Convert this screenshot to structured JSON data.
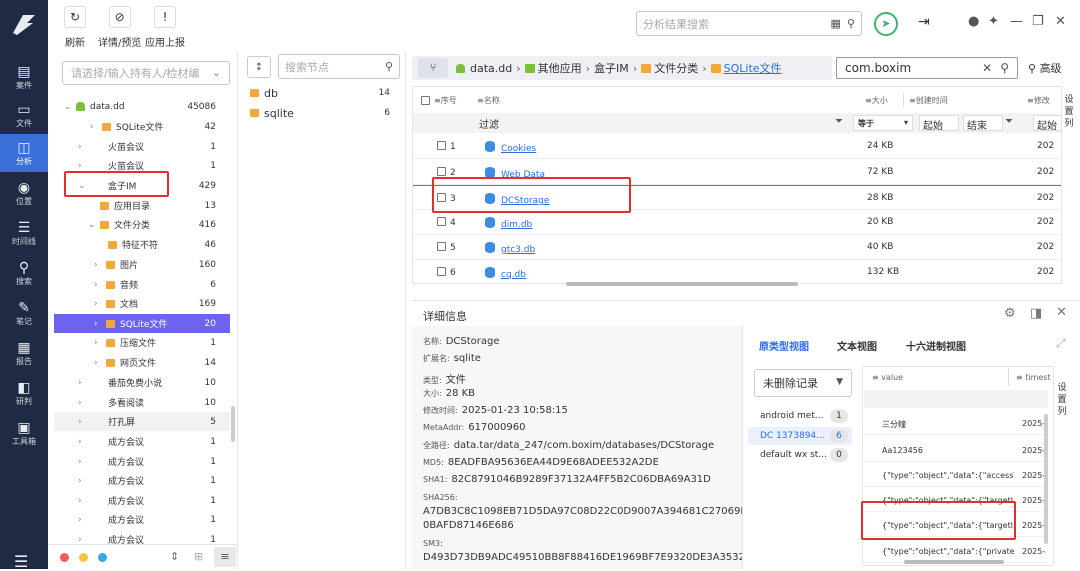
{
  "toolbar": {
    "refresh": "刷新",
    "details": "详情/预览",
    "report": "应用上报",
    "result_search_placeholder": "分析结果搜索"
  },
  "nav": [
    {
      "label": "案件",
      "icon": "case-icon"
    },
    {
      "label": "文件",
      "icon": "file-icon"
    },
    {
      "label": "分析",
      "icon": "analysis-icon"
    },
    {
      "label": "位置",
      "icon": "location-icon"
    },
    {
      "label": "时间线",
      "icon": "timeline-icon"
    },
    {
      "label": "搜索",
      "icon": "search-icon"
    },
    {
      "label": "笔记",
      "icon": "notes-icon"
    },
    {
      "label": "报告",
      "icon": "report-icon"
    },
    {
      "label": "研判",
      "icon": "judge-icon"
    },
    {
      "label": "工具箱",
      "icon": "toolbox-icon"
    }
  ],
  "tree": {
    "evidence_placeholder": "请选择/输入持有人/检材编",
    "rows": [
      {
        "label": "data.dd",
        "count": "45086"
      },
      {
        "label": "SQLite文件",
        "count": "42"
      },
      {
        "label": "火苗会议",
        "count": "1"
      },
      {
        "label": "火苗会议",
        "count": "1"
      },
      {
        "label": "盒子IM",
        "count": "429"
      },
      {
        "label": "应用目录",
        "count": "13"
      },
      {
        "label": "文件分类",
        "count": "416"
      },
      {
        "label": "特征不符",
        "count": "46"
      },
      {
        "label": "图片",
        "count": "160"
      },
      {
        "label": "音频",
        "count": "6"
      },
      {
        "label": "文档",
        "count": "169"
      },
      {
        "label": "SQLite文件",
        "count": "20"
      },
      {
        "label": "压缩文件",
        "count": "1"
      },
      {
        "label": "网页文件",
        "count": "14"
      },
      {
        "label": "番茄免费小说",
        "count": "10"
      },
      {
        "label": "多看阅读",
        "count": "10"
      },
      {
        "label": "打孔屏",
        "count": "5"
      },
      {
        "label": "成方会议",
        "count": "1"
      },
      {
        "label": "成方会议",
        "count": "1"
      },
      {
        "label": "成方会议",
        "count": "1"
      },
      {
        "label": "成方会议",
        "count": "1"
      },
      {
        "label": "成方会议",
        "count": "1"
      },
      {
        "label": "成方会议",
        "count": "1"
      }
    ]
  },
  "nodes": {
    "search_placeholder": "搜索节点",
    "items": [
      {
        "label": "db",
        "count": "14"
      },
      {
        "label": "sqlite",
        "count": "6"
      }
    ]
  },
  "breadcrumb": [
    "data.dd",
    "其他应用",
    "盒子IM",
    "文件分类",
    "SQLite文件"
  ],
  "filter": {
    "value": "com.boxim",
    "advanced": "高级"
  },
  "grid": {
    "headers": [
      "序号",
      "名称",
      "大小",
      "创建时间",
      "修改"
    ],
    "filter_label": "过滤",
    "size_op": "等于",
    "start": "起始",
    "end": "结束",
    "start2": "起始",
    "set_columns": "设置列",
    "rows": [
      {
        "num": "1",
        "name": "Cookies",
        "size": "24 KB",
        "date": "202"
      },
      {
        "num": "2",
        "name": "Web Data",
        "size": "72 KB",
        "date": "202"
      },
      {
        "num": "3",
        "name": "DCStorage",
        "size": "28 KB",
        "date": "202"
      },
      {
        "num": "4",
        "name": "dim.db",
        "size": "20 KB",
        "date": "202"
      },
      {
        "num": "5",
        "name": "gtc3.db",
        "size": "40 KB",
        "date": "202"
      },
      {
        "num": "6",
        "name": "cq.db",
        "size": "132 KB",
        "date": "202"
      }
    ]
  },
  "detail": {
    "title": "详细信息",
    "fields": [
      {
        "k": "名称:",
        "v": "DCStorage"
      },
      {
        "k": "扩展名:",
        "v": "sqlite"
      },
      {
        "k": "类型:",
        "v": "文件"
      },
      {
        "k": "大小:",
        "v": "28 KB"
      },
      {
        "k": "修改时间:",
        "v": "2025-01-23 10:58:15"
      },
      {
        "k": "MetaAddr:",
        "v": "617000960"
      },
      {
        "k": "全路径:",
        "v": "data.tar/data_247/com.boxim/databases/DCStorage"
      },
      {
        "k": "MD5:",
        "v": "8EADFBA95636EA44D9E68ADEE532A2DE"
      },
      {
        "k": "SHA1:",
        "v": "82C8791046B9289F37132A4FF5B2C06DBA69A31D"
      }
    ],
    "sha256_label": "SHA256:",
    "sha256_1": "A7DB3C8C1098EB71D5DA97C08D22C0D9007A394681C27069B2",
    "sha256_2": "0BAFD87146E686",
    "sm3_label": "SM3:",
    "sm3_1": "D493D73DB9ADC49510BB8F88416DE1969BF7E9320DE3A3532A"
  },
  "views": {
    "tabs": [
      "原类型视图",
      "文本视图",
      "十六进制视图"
    ],
    "record_filter": "未删除记录",
    "tables": [
      {
        "label": "android met...",
        "count": "1"
      },
      {
        "label": "DC 1373894...",
        "count": "6"
      },
      {
        "label": "default wx st...",
        "count": "0"
      }
    ],
    "col_value": "value",
    "col_time": "timest",
    "set_columns": "设置列",
    "rows": [
      {
        "value": "三分幢",
        "time": "2025-"
      },
      {
        "value": "Aa123456",
        "time": "2025-"
      },
      {
        "value": "{\"type\":\"object\",\"data\":{\"accessT...",
        "time": "2025-"
      },
      {
        "value": "{\"type\":\"object\",\"data\":{\"targetl...",
        "time": "2025-"
      },
      {
        "value": "{\"type\":\"object\",\"data\":{\"targetl...",
        "time": "2025-"
      },
      {
        "value": "{\"type\":\"object\",\"data\":{\"private...",
        "time": "2025-"
      }
    ]
  }
}
